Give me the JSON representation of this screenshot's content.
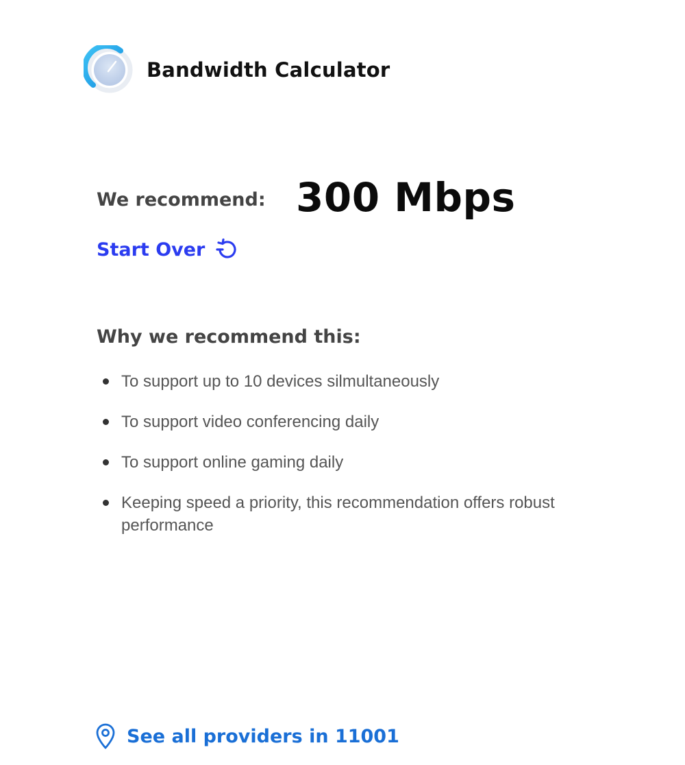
{
  "header": {
    "logo_icon": "speedometer-gauge-icon",
    "title": "Bandwidth Calculator"
  },
  "recommendation": {
    "label": "We recommend:",
    "value": "300 Mbps"
  },
  "start_over": {
    "label": "Start Over",
    "icon": "restart-icon"
  },
  "reasons": {
    "heading": "Why we recommend this:",
    "items": [
      "To support up to 10 devices silmultaneously",
      "To support video conferencing daily",
      "To support online gaming daily",
      "Keeping speed a priority, this recommendation offers robust performance"
    ]
  },
  "providers": {
    "icon": "location-pin-icon",
    "label": "See all providers in 11001"
  },
  "colors": {
    "link_primary": "#2b3cf0",
    "link_secondary": "#1a6fd6",
    "gauge_accent": "#1aa7e8",
    "heading_gray": "#444444",
    "body_gray": "#555555"
  }
}
